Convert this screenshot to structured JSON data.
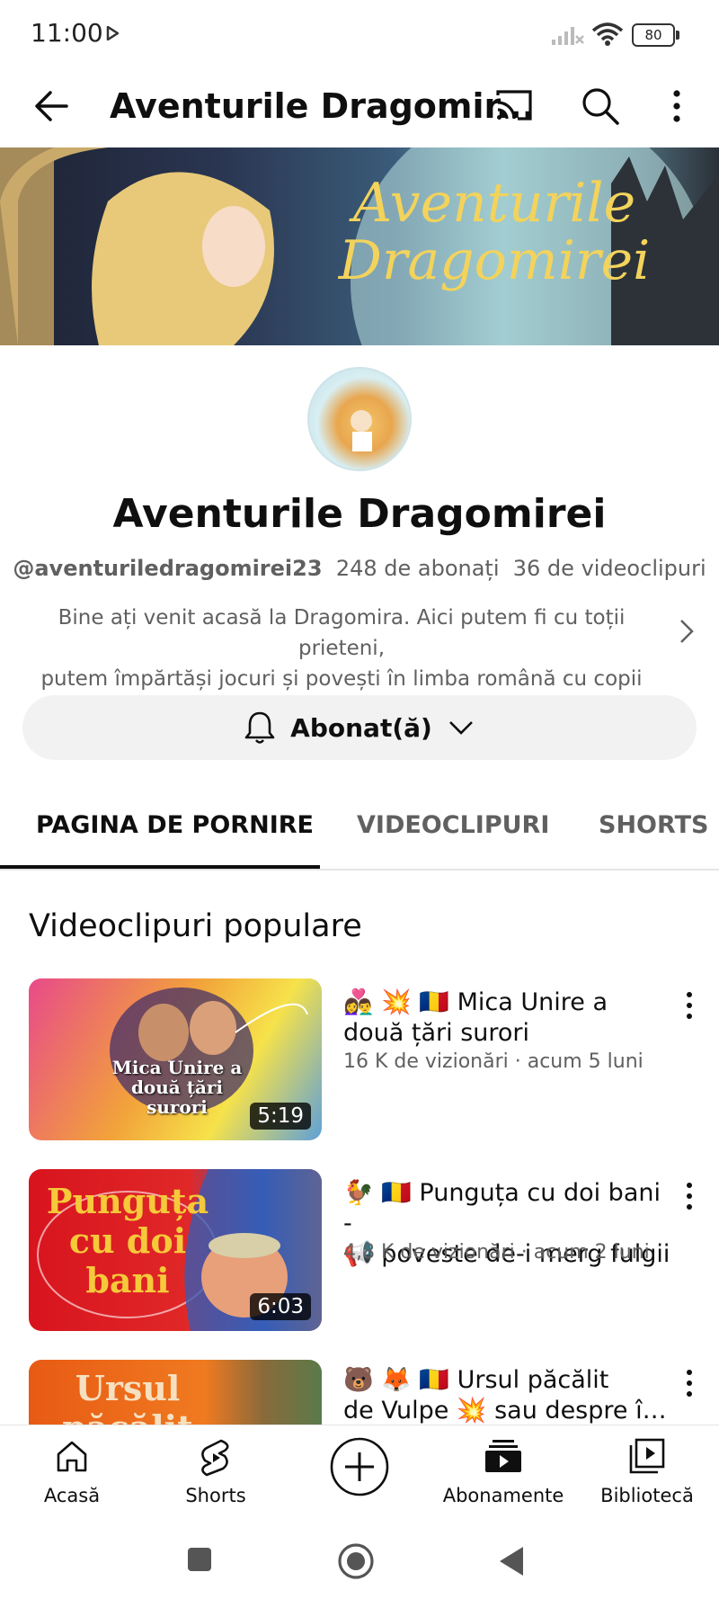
{
  "status_bar": {
    "time": "11:00",
    "battery": "80"
  },
  "app_bar": {
    "title": "Aventurile Dragomir..."
  },
  "banner": {
    "line1": "Aventurile",
    "line2": "Dragomirei"
  },
  "channel": {
    "name": "Aventurile Dragomirei",
    "handle": "@aventuriledragomirei23",
    "subscribers": "248 de abonați",
    "videos": "36 de videoclipuri",
    "description_line1": "Bine ați venit acasă la Dragomira. Aici putem fi cu toții prieteni,",
    "description_line2": "putem împărtăși jocuri și povești în limba română cu copii din t…"
  },
  "subscribe": {
    "label": "Abonat(ă)"
  },
  "tabs": [
    {
      "label": "PAGINA DE PORNIRE",
      "selected": true
    },
    {
      "label": "VIDEOCLIPURI",
      "selected": false
    },
    {
      "label": "SHORTS",
      "selected": false
    }
  ],
  "section": {
    "title": "Videoclipuri populare"
  },
  "videos": [
    {
      "title_line1": "👩‍❤️‍👨 💥 🇷🇴  Mica Unire a",
      "title_line2": "două țări surori",
      "meta": "16 K de vizionări · acum 5 luni",
      "duration": "5:19",
      "thumb_text": "Mica Unire a două țări surori"
    },
    {
      "title_line1": "🐓 🇷🇴 Punguța cu doi bani -",
      "title_line2": "📢 poveste de-i merg fulgii",
      "meta": "4,8 K de vizionări · acum 2 luni",
      "duration": "6:03",
      "thumb_text": "Punguța cu doi bani"
    },
    {
      "title_line1": "🐻 🦊 🇷🇴 Ursul păcălit",
      "title_line2": "de Vulpe  💥 sau despre î…",
      "meta": "",
      "duration": "",
      "thumb_text": "Ursul păcălit"
    }
  ],
  "bottom_nav": [
    {
      "label": "Acasă"
    },
    {
      "label": "Shorts"
    },
    {
      "label": ""
    },
    {
      "label": "Abonamente"
    },
    {
      "label": "Bibliotecă"
    }
  ],
  "colors": {
    "text_primary": "#0f0f0f",
    "text_secondary": "#606060",
    "subscribe_bg": "#f2f2f2",
    "banner_gold": "#f3d35c"
  }
}
